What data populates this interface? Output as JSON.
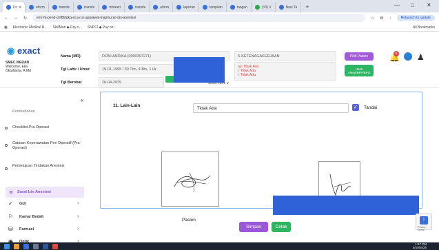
{
  "browser": {
    "tabs": [
      {
        "label": "Dr. ✕",
        "active": true
      },
      {
        "label": "eform"
      },
      {
        "label": "transfe"
      },
      {
        "label": "transfe"
      },
      {
        "label": "mmeeri"
      },
      {
        "label": "transfe"
      },
      {
        "label": "eform"
      },
      {
        "label": "laporan"
      },
      {
        "label": "tampilan"
      },
      {
        "label": "tangan"
      },
      {
        "label": "(13) V"
      },
      {
        "label": "New Ta"
      }
    ],
    "new_tab": "+",
    "url": "emr-fe-pend-uhf8bfgkq-et.a.run.app/awat-inap/surat-izin-anestesi",
    "relaunch": "Relaunch to update",
    "bookmarks": [
      "Electronic Medical R...",
      "SkillMan ◆ Pay o...",
      "SNPCI ◆ Pay on..."
    ],
    "all_bookmarks": "All Bookmarks"
  },
  "header": {
    "logo": "exact",
    "org": "SMEC MEDAN",
    "welcome": "Welcome, Eka",
    "user": "Oktaflarita, A.Md",
    "nama_label": "Nama (MR)",
    "nama_value": "DONI ANDIKA (0000397271)",
    "tgl_lahir_label": "Tgl Lahir / Umur",
    "tgl_lahir_value": "19-01-1995 / 30 Thn, 4 Bln, 1 Hr",
    "tgl_berobat_label": "Tgl Berobat",
    "tgl_berobat_value": "26-04-2025",
    "penjamin_value": "S KETENAGAKERJAAN",
    "alergi_lines": [
      "rgi: Tidak Ada",
      "l: Tidak Ada",
      "l: Tidak Ada"
    ],
    "show_more": "Show more ∨",
    "pilih_pasien": "Pilih Pasien",
    "ubah_alergi": "Ubah Alergi/BPP/BPO",
    "notif_count": "6"
  },
  "sidebar": {
    "pembedahan": "Pembedahan",
    "checklist": "Checklist Pra Operasi",
    "catatan": "Catatan Keperawatan Peri Operatif (Pra-Operasi)",
    "persetujuan": "Persetujuan Tindakan Anestesi",
    "surat_izin": "Surat Izin Anestesi",
    "groups": [
      "Gizi",
      "Kamar Bedah",
      "Farmasi",
      "Optik"
    ],
    "collapse": "«"
  },
  "form": {
    "lain_label": "11. Lain-Lain",
    "lain_value": "Tidak Ada",
    "tandai": "Tandai",
    "pasien_label": "Pasien",
    "simpan": "Simpan",
    "cetak": "Cetak"
  },
  "taskbar": {
    "time": "1:57 PM",
    "date": "5/19/2025"
  },
  "colors": {
    "accent_purple": "#9a57d6",
    "accent_green": "#2eb562",
    "mask_blue": "#2f62d6"
  }
}
